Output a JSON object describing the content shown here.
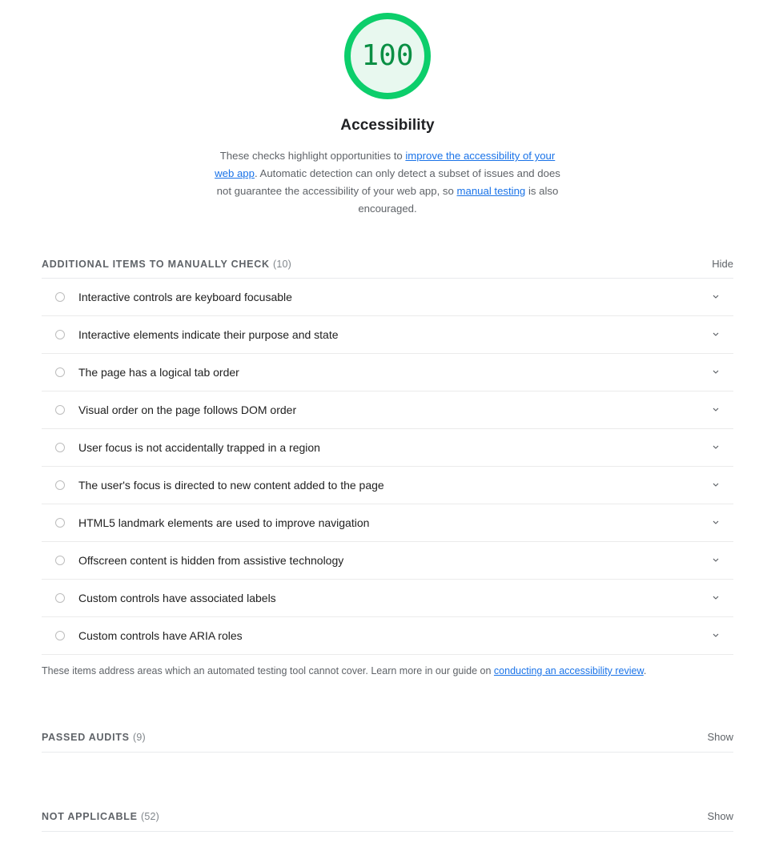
{
  "score": {
    "value": "100",
    "category_title": "Accessibility",
    "gauge_color": "#0cce6b",
    "gauge_fill": "#e8f8ef",
    "gauge_text_color": "#0a8f44"
  },
  "description": {
    "part1": "These checks highlight opportunities to ",
    "link1": "improve the accessibility of your web app",
    "part2": ". Automatic detection can only detect a subset of issues and does not guarantee the accessibility of your web app, so ",
    "link2": "manual testing",
    "part3": " is also encouraged."
  },
  "manual_section": {
    "title": "ADDITIONAL ITEMS TO MANUALLY CHECK",
    "count": "(10)",
    "toggle_label": "Hide",
    "items": [
      {
        "label": "Interactive controls are keyboard focusable"
      },
      {
        "label": "Interactive elements indicate their purpose and state"
      },
      {
        "label": "The page has a logical tab order"
      },
      {
        "label": "Visual order on the page follows DOM order"
      },
      {
        "label": "User focus is not accidentally trapped in a region"
      },
      {
        "label": "The user's focus is directed to new content added to the page"
      },
      {
        "label": "HTML5 landmark elements are used to improve navigation"
      },
      {
        "label": "Offscreen content is hidden from assistive technology"
      },
      {
        "label": "Custom controls have associated labels"
      },
      {
        "label": "Custom controls have ARIA roles"
      }
    ],
    "footnote_part1": "These items address areas which an automated testing tool cannot cover. Learn more in our guide on ",
    "footnote_link": "conducting an accessibility review",
    "footnote_part2": "."
  },
  "passed_section": {
    "title": "PASSED AUDITS",
    "count": "(9)",
    "toggle_label": "Show"
  },
  "not_applicable_section": {
    "title": "NOT APPLICABLE",
    "count": "(52)",
    "toggle_label": "Show"
  },
  "colors": {
    "link": "#1a73e8",
    "muted": "#5f6368",
    "divider": "#e8eaed"
  }
}
